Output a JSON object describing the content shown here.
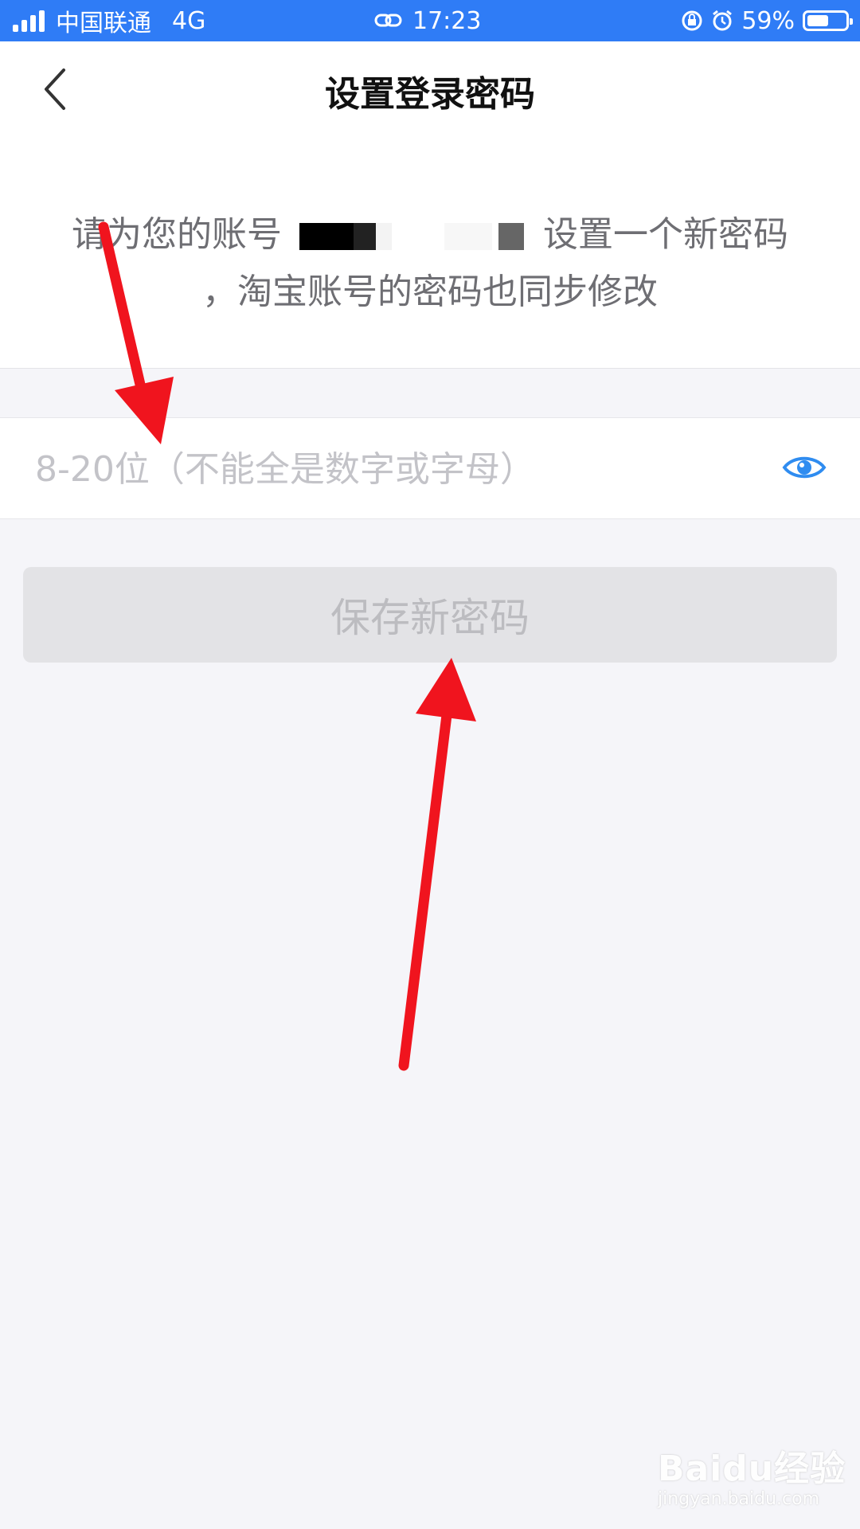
{
  "status_bar": {
    "carrier": "中国联通",
    "network": "4G",
    "time": "17:23",
    "battery": "59%",
    "battery_level": 0.59,
    "icons": [
      "signal-icon",
      "link-icon",
      "rotation-lock-icon",
      "alarm-icon",
      "battery-icon"
    ]
  },
  "nav": {
    "title": "设置登录密码",
    "back_icon": "chevron-left-icon"
  },
  "description": {
    "line1_prefix": "请为您的账号",
    "line1_suffix": "设置一个新密码",
    "line2": "，淘宝账号的密码也同步修改"
  },
  "password_input": {
    "placeholder": "8-20位（不能全是数字或字母）",
    "value": "",
    "toggle_icon": "eye-icon"
  },
  "save_button": {
    "label": "保存新密码"
  },
  "watermark": {
    "brand": "Baidu经验",
    "url": "jingyan.baidu.com"
  },
  "colors": {
    "status_bar": "#2f7cf6",
    "accent": "#2f8cf0",
    "annotation_arrow": "#f0141e",
    "disabled_button": "#e3e3e6"
  }
}
